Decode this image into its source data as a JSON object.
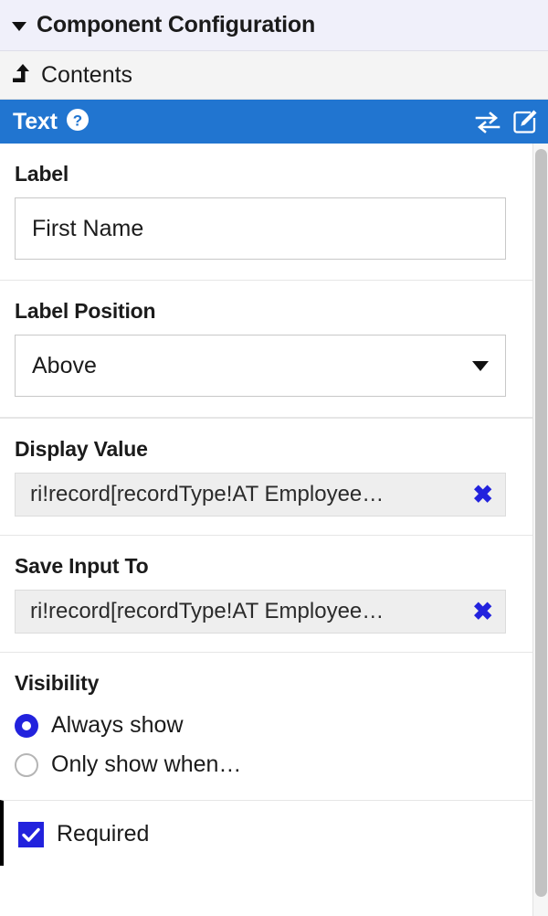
{
  "config_bar": {
    "title": "Component Configuration",
    "caret_icon": "caret-down-icon",
    "background": "#f0f0fa"
  },
  "breadcrumb": {
    "label": "Contents",
    "icon": "level-up-icon",
    "background": "#f4f4f4"
  },
  "component_header": {
    "title": "Text",
    "help_icon": "help-circle-icon",
    "swap_icon": "swap-arrows-icon",
    "edit_icon": "edit-pencil-square-icon",
    "background": "#2175d0",
    "text_color": "#ffffff"
  },
  "fields": {
    "label": {
      "label": "Label",
      "value": "First Name",
      "placeholder": ""
    },
    "label_position": {
      "label": "Label Position",
      "value": "Above",
      "caret_icon": "chevron-down-icon"
    },
    "display_value": {
      "label": "Display Value",
      "value": "ri!record[recordType!AT Employee…",
      "clear_icon": "clear-x-icon"
    },
    "save_input_to": {
      "label": "Save Input To",
      "value": "ri!record[recordType!AT Employee…",
      "clear_icon": "clear-x-icon"
    },
    "visibility": {
      "label": "Visibility",
      "options": [
        {
          "label": "Always show",
          "selected": true
        },
        {
          "label": "Only show when…",
          "selected": false
        }
      ]
    },
    "required": {
      "label": "Required",
      "checked": true
    }
  },
  "colors": {
    "accent_blue": "#2222dd",
    "header_blue": "#2175d0",
    "chip_background": "#eeeeee",
    "focus_outline": "#000000"
  },
  "scrollbar": {
    "thumb_color": "#c2c2c2",
    "track_color": "#f6f6f6"
  }
}
